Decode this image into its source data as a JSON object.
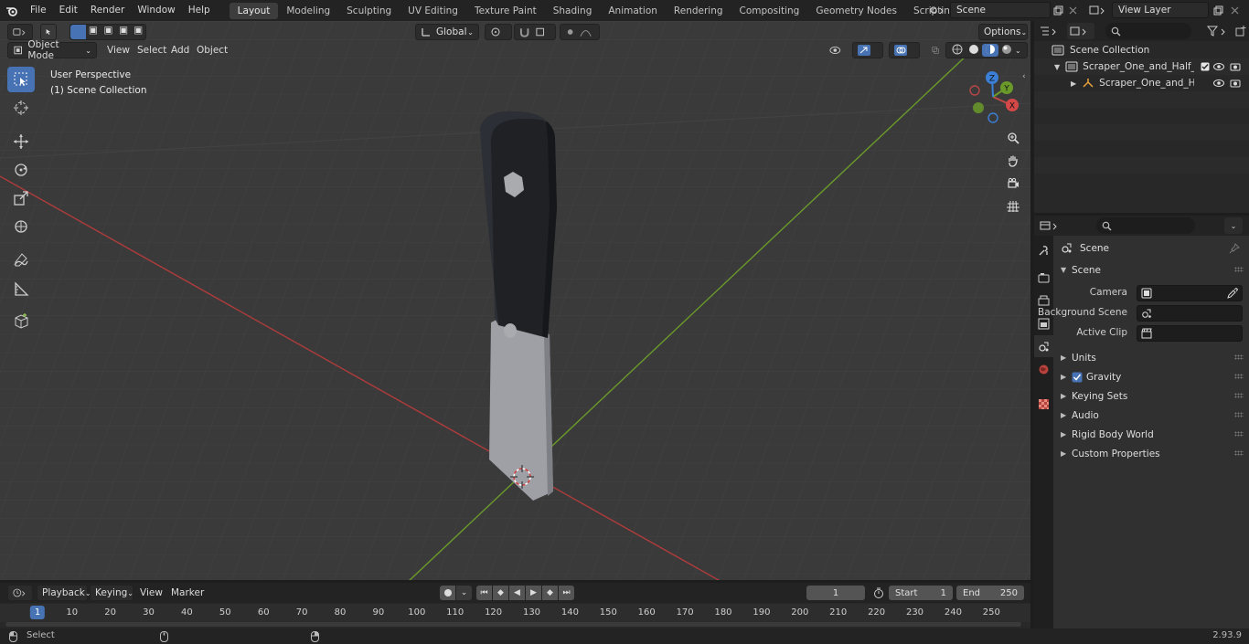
{
  "menu": [
    "File",
    "Edit",
    "Render",
    "Window",
    "Help"
  ],
  "workspaces": [
    {
      "label": "Layout",
      "active": true
    },
    {
      "label": "Modeling"
    },
    {
      "label": "Sculpting"
    },
    {
      "label": "UV Editing"
    },
    {
      "label": "Texture Paint"
    },
    {
      "label": "Shading"
    },
    {
      "label": "Animation"
    },
    {
      "label": "Rendering"
    },
    {
      "label": "Compositing"
    },
    {
      "label": "Geometry Nodes"
    },
    {
      "label": "Scripting"
    }
  ],
  "add_workspace": "+",
  "scene_field": "Scene",
  "view_layer_field": "View Layer",
  "viewport": {
    "mode": "Object Mode",
    "menus": [
      "View",
      "Select",
      "Add",
      "Object"
    ],
    "transform_orientation": "Global",
    "options_label": "Options",
    "overlay_line1": "User Perspective",
    "overlay_line2": "(1) Scene Collection",
    "gizmo": {
      "z": "Z",
      "y": "Y",
      "x": "X"
    }
  },
  "outliner": {
    "root": "Scene Collection",
    "collection": "Scraper_One_and_Half_Inch_L",
    "object": "Scraper_One_and_Half_Ir"
  },
  "properties": {
    "context_title": "Scene",
    "panel_title": "Scene",
    "fields": [
      {
        "label": "Camera",
        "value": ""
      },
      {
        "label": "Background Scene",
        "value": ""
      },
      {
        "label": "Active Clip",
        "value": ""
      }
    ],
    "subpanels": [
      "Units",
      "Gravity",
      "Keying Sets",
      "Audio",
      "Rigid Body World",
      "Custom Properties"
    ]
  },
  "timeline": {
    "menus": [
      "Playback",
      "Keying",
      "View",
      "Marker"
    ],
    "current_frame": "1",
    "start_label": "Start",
    "start_value": "1",
    "end_label": "End",
    "end_value": "250",
    "ruler_marks": [
      "1",
      "10",
      "20",
      "30",
      "40",
      "50",
      "60",
      "70",
      "80",
      "90",
      "100",
      "110",
      "120",
      "130",
      "140",
      "150",
      "160",
      "170",
      "180",
      "190",
      "200",
      "210",
      "220",
      "230",
      "240",
      "250"
    ]
  },
  "status": {
    "left_label": "Select",
    "version": "2.93.9"
  },
  "colors": {
    "accent": "#4772b3",
    "x_axis": "#c04848",
    "y_axis": "#6a9a2a",
    "z_axis": "#3b7fd6"
  }
}
